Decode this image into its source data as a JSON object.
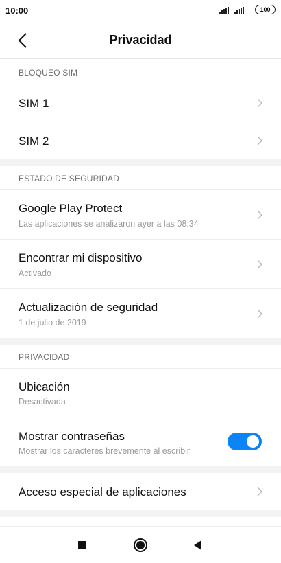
{
  "status_bar": {
    "time": "10:00",
    "battery": "100"
  },
  "header": {
    "title": "Privacidad",
    "back_icon": "chevron-left-icon"
  },
  "sections": {
    "sim_lock": {
      "header": "BLOQUEO SIM",
      "items": [
        {
          "title": "SIM 1"
        },
        {
          "title": "SIM 2"
        }
      ]
    },
    "security_status": {
      "header": "ESTADO DE SEGURIDAD",
      "items": [
        {
          "title": "Google Play Protect",
          "subtitle": "Las aplicaciones se analizaron ayer a las 08:34"
        },
        {
          "title": "Encontrar mi dispositivo",
          "subtitle": "Activado"
        },
        {
          "title": "Actualización de seguridad",
          "subtitle": "1 de julio de 2019"
        }
      ]
    },
    "privacy": {
      "header": "PRIVACIDAD",
      "items": [
        {
          "title": "Ubicación",
          "subtitle": "Desactivada"
        },
        {
          "title": "Mostrar contraseñas",
          "subtitle": "Mostrar los caracteres brevemente al escribir",
          "toggle_on": true
        }
      ]
    },
    "special": {
      "items": [
        {
          "title": "Acceso especial de aplicaciones"
        }
      ]
    }
  },
  "colors": {
    "accent": "#0b84f7",
    "section_header": "#6f6f6f",
    "subtitle": "#9b9b9b",
    "gap_background": "#f3f3f3"
  },
  "nav_bar": {
    "recents_icon": "square-icon",
    "home_icon": "circle-home-icon",
    "back_icon": "triangle-back-icon"
  }
}
